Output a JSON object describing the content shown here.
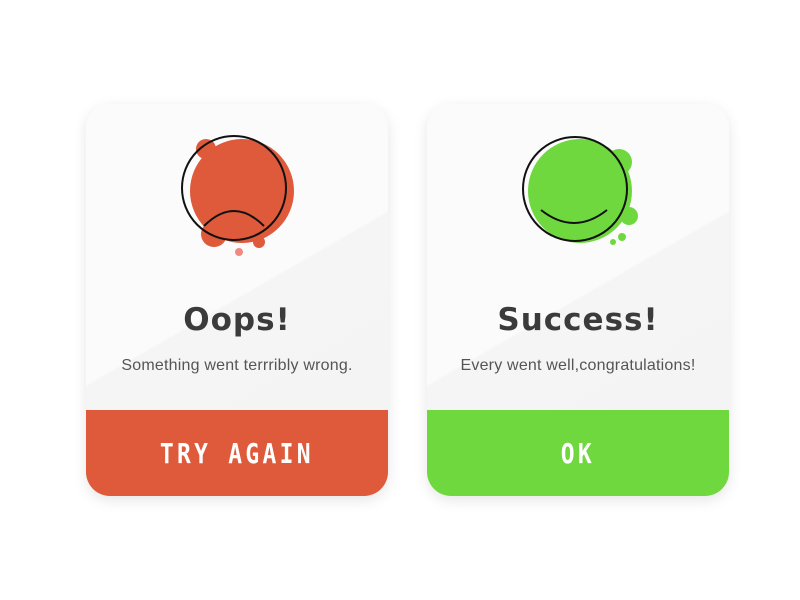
{
  "cards": {
    "error": {
      "title": "Oops!",
      "message": "Something went terrribly wrong.",
      "button_label": "TRY AGAIN",
      "color": "#de5a3a",
      "icon": "sad-face-icon"
    },
    "success": {
      "title": "Success!",
      "message": "Every went well,congratulations!",
      "button_label": "OK",
      "color": "#6fd83f",
      "icon": "happy-face-icon"
    }
  }
}
